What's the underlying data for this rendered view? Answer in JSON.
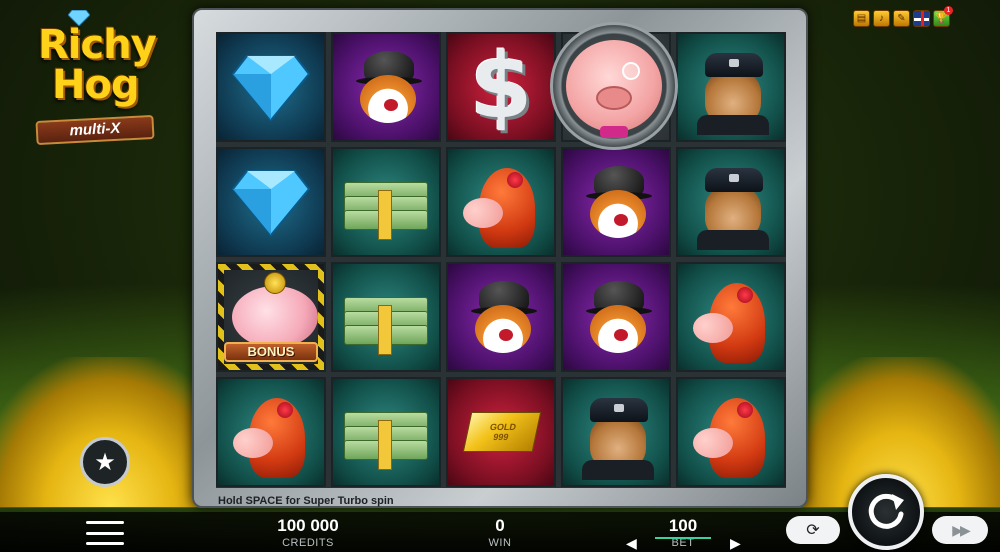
{
  "game": {
    "logo_line1": "Richy",
    "logo_line2": "Hog",
    "logo_sub": "multi-X"
  },
  "top_icons": [
    "paytable-icon",
    "sound-icon",
    "settings-icon",
    "language-flag-icon",
    "trophy-icon"
  ],
  "trophy_badge": "1",
  "reels": {
    "rows": [
      [
        "diamond",
        "fox-bowler",
        "dollar",
        "pig-boss",
        "bulldog-cop"
      ],
      [
        "diamond",
        "cash-stack",
        "lady-pig",
        "fox-bowler",
        "bulldog-cop"
      ],
      [
        "bonus-piggy",
        "cash-stack",
        "fox-bowler",
        "fox-bowler",
        "lady-pig"
      ],
      [
        "lady-pig",
        "cash-stack",
        "gold-bar",
        "bulldog-cop",
        "lady-pig"
      ]
    ],
    "bonus_label": "BONUS",
    "gold_bar_text_1": "GOLD",
    "gold_bar_text_2": "999"
  },
  "hint": "Hold SPACE for Super Turbo spin",
  "bottom": {
    "credits_value": "100 000",
    "credits_label": "CREDITS",
    "win_value": "0",
    "win_label": "WIN",
    "bet_value": "100",
    "bet_label": "BET"
  },
  "colors": {
    "accent_logo": "#ffd21a",
    "bet_underline": "#3ad0a0"
  }
}
